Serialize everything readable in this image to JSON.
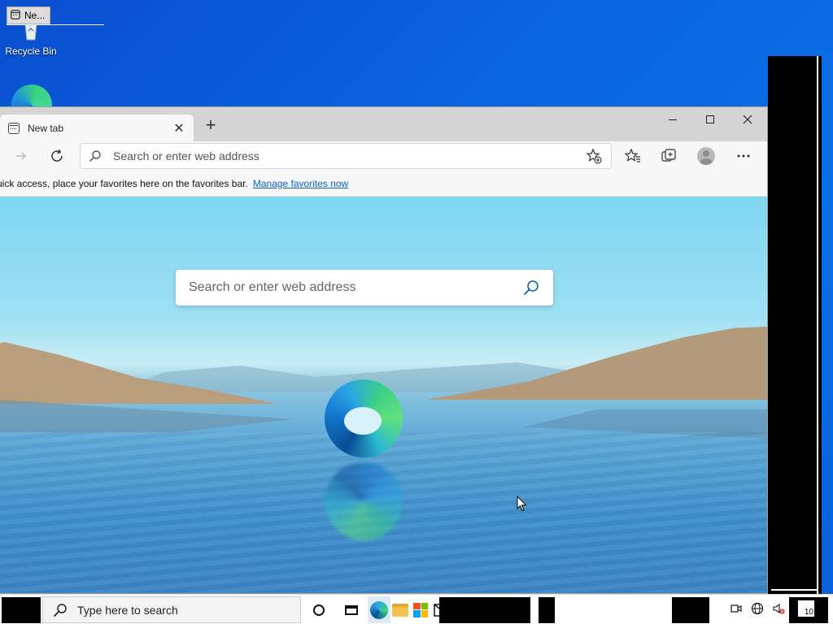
{
  "desktop": {
    "icons": [
      {
        "label": "Recycle Bin"
      }
    ],
    "tooltip_tab": {
      "label": "Ne..."
    }
  },
  "browser": {
    "tab": {
      "title": "New tab",
      "close": "✕"
    },
    "new_tab": "+",
    "address": {
      "placeholder": "Search or enter web address"
    },
    "favorites_bar": {
      "message": "uick access, place your favorites here on the favorites bar.",
      "link": "Manage favorites now"
    },
    "hero_search": {
      "placeholder": "Search or enter web address"
    }
  },
  "taskbar": {
    "search_placeholder": "Type here to search",
    "notification_count": "10"
  },
  "colors": {
    "desktop_bg": "#0a64e0",
    "accent": "#0b63c7"
  },
  "icons": {
    "search": "search-icon",
    "refresh": "refresh-icon",
    "forward": "forward-arrow-icon",
    "favorite_add": "star-plus-icon",
    "favorites": "favorites-icon",
    "collections": "collections-icon",
    "profile": "profile-icon",
    "more": "more-icon"
  }
}
